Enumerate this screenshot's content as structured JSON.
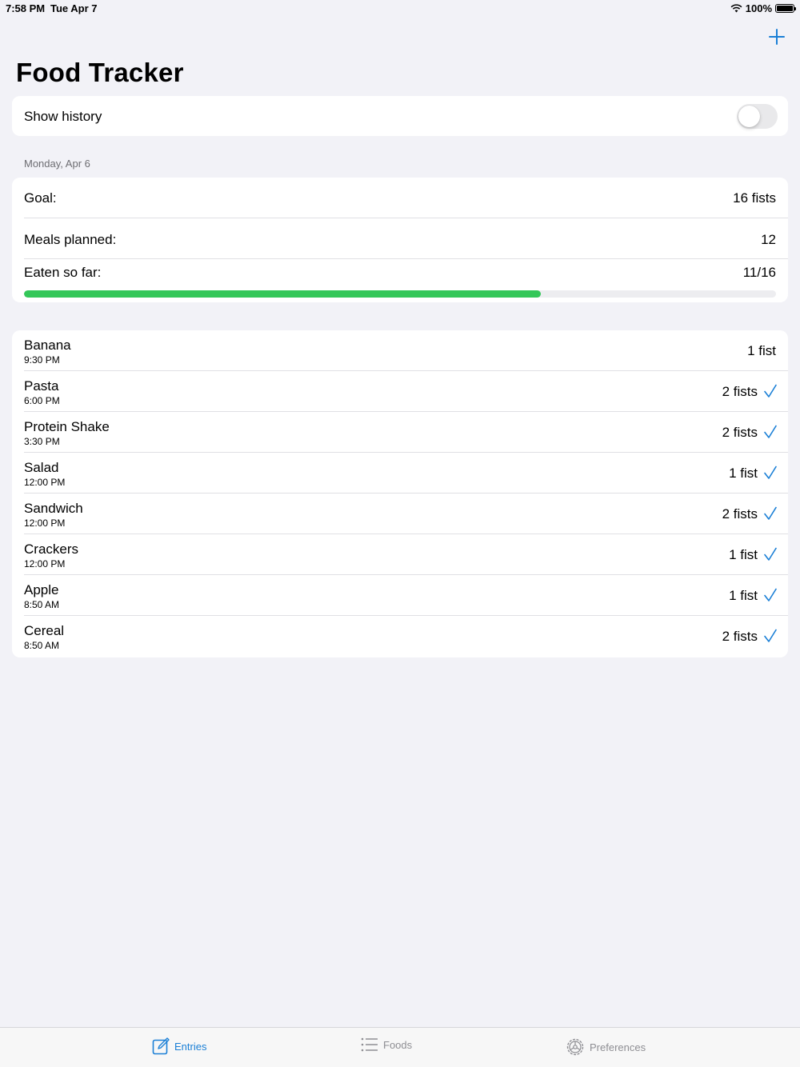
{
  "status": {
    "time": "7:58 PM",
    "date": "Tue Apr 7",
    "battery": "100%"
  },
  "header": {
    "title": "Food Tracker",
    "add_icon": "plus-icon"
  },
  "history": {
    "label": "Show history",
    "enabled": false
  },
  "section": {
    "date": "Monday, Apr 6"
  },
  "summary": {
    "goal_label": "Goal:",
    "goal_value": "16 fists",
    "planned_label": "Meals planned:",
    "planned_value": "12",
    "eaten_label": "Eaten so far:",
    "eaten_value": "11/16",
    "progress_fraction": 0.6875
  },
  "entries": [
    {
      "name": "Banana",
      "time": "9:30 PM",
      "amount": "1 fist",
      "checked": false
    },
    {
      "name": "Pasta",
      "time": "6:00 PM",
      "amount": "2 fists",
      "checked": true
    },
    {
      "name": "Protein Shake",
      "time": "3:30 PM",
      "amount": "2 fists",
      "checked": true
    },
    {
      "name": "Salad",
      "time": "12:00 PM",
      "amount": "1 fist",
      "checked": true
    },
    {
      "name": "Sandwich",
      "time": "12:00 PM",
      "amount": "2 fists",
      "checked": true
    },
    {
      "name": "Crackers",
      "time": "12:00 PM",
      "amount": "1 fist",
      "checked": true
    },
    {
      "name": "Apple",
      "time": "8:50 AM",
      "amount": "1 fist",
      "checked": true
    },
    {
      "name": "Cereal",
      "time": "8:50 AM",
      "amount": "2 fists",
      "checked": true
    }
  ],
  "tabs": [
    {
      "label": "Entries",
      "icon": "compose-icon",
      "active": true
    },
    {
      "label": "Foods",
      "icon": "list-icon",
      "active": false
    },
    {
      "label": "Preferences",
      "icon": "gear-icon",
      "active": false
    }
  ],
  "colors": {
    "accent": "#1a7fd6",
    "progress": "#34c759",
    "background": "#f2f2f7"
  }
}
